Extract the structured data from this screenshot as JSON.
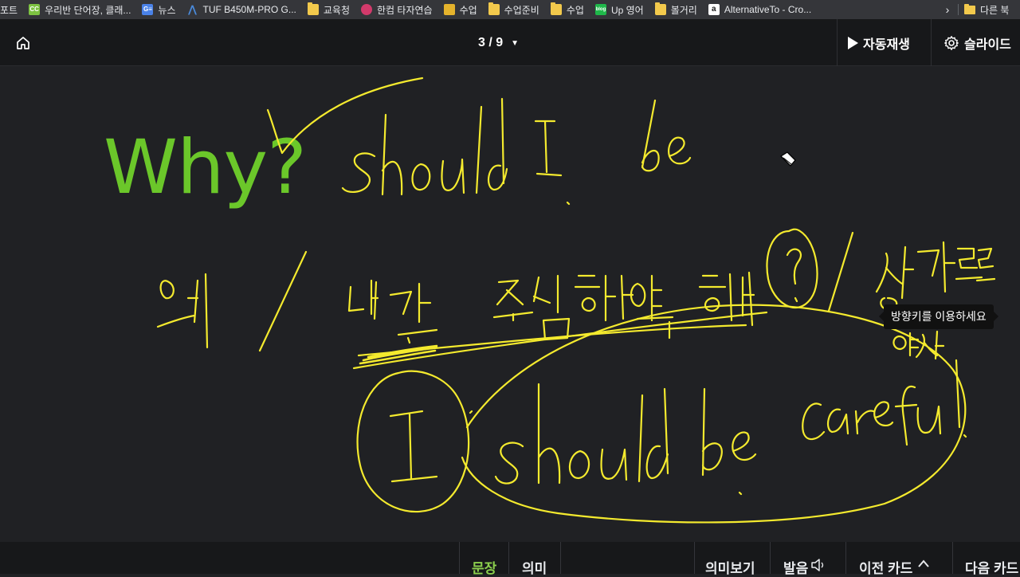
{
  "bookmarks": {
    "items": [
      {
        "label": "포트",
        "icon": "none"
      },
      {
        "label": "우리반 단어장, 클래...",
        "icon": "classcard-icon"
      },
      {
        "label": "뉴스",
        "icon": "google-news-icon"
      },
      {
        "label": "TUF B450M-PRO G...",
        "icon": "asus-icon"
      },
      {
        "label": "교육청",
        "icon": "folder-icon"
      },
      {
        "label": "한컴 타자연습",
        "icon": "hancom-icon"
      },
      {
        "label": "수업",
        "icon": "classroom-icon"
      },
      {
        "label": "수업준비",
        "icon": "folder-icon"
      },
      {
        "label": "수업",
        "icon": "folder-icon"
      },
      {
        "label": "Up 영어",
        "icon": "blog-icon"
      },
      {
        "label": "볼거리",
        "icon": "folder-icon"
      },
      {
        "label": "AlternativeTo - Cro...",
        "icon": "alternativeto-icon"
      }
    ],
    "more": "›",
    "other": "다른 북"
  },
  "toolbar": {
    "page": "3 / 9",
    "autoplay_label": "자동재생",
    "settings_label": "슬라이드"
  },
  "slide": {
    "title": "Why?",
    "tooltip": "방향키를 이용하세요",
    "handwriting": [
      "should I be",
      "왜 / 내가 조심해야만 하나? / 상가로로",
      "여서",
      "I should be careful."
    ]
  },
  "bottom": {
    "tab_sentence": "문장",
    "tab_meaning": "의미",
    "view_meaning": "의미보기",
    "pronounce": "발음",
    "prev_card": "이전 카드",
    "next_card": "다음 카드"
  },
  "colors": {
    "accent_green": "#6bc72a",
    "ink_yellow": "#f4ea2e",
    "background": "#202124",
    "toolbar": "#17181a"
  }
}
